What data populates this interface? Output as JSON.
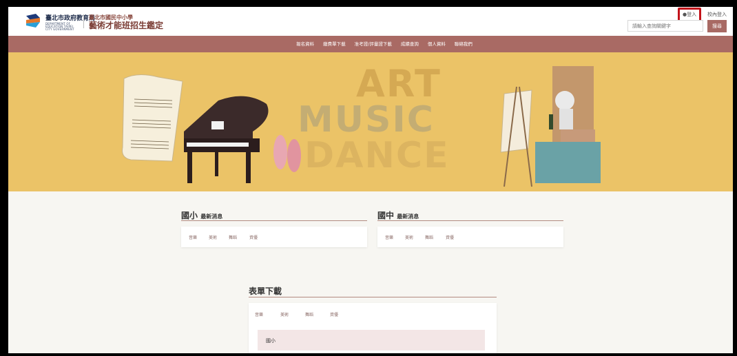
{
  "header": {
    "org_name": "臺北市政府教育局",
    "org_sub": "DEPARTMENT OF EDUCATION TAIPEI CITY GOVERNMENT",
    "site_sub": "臺北市國民中小學",
    "site_title": "藝術才能班招生鑑定",
    "login_label": "登入",
    "teacher_login_label": "校內登入",
    "search_placeholder": "請輸入查詢關鍵字",
    "search_button": "搜尋"
  },
  "nav": {
    "items": [
      "報名資料",
      "繳費單下載",
      "准考證/評量證下載",
      "成績查詢",
      "個人資料",
      "聯絡我們"
    ]
  },
  "banner": {
    "line1": "ART",
    "line2": "MUSIC",
    "line3": "DANCE"
  },
  "news": {
    "elementary": {
      "title": "國小",
      "suffix": "最新消息",
      "tabs": [
        "音樂",
        "美術",
        "舞蹈",
        "資優"
      ]
    },
    "junior": {
      "title": "國中",
      "suffix": "最新消息",
      "tabs": [
        "音樂",
        "美術",
        "舞蹈",
        "資優"
      ]
    }
  },
  "forms": {
    "title": "表單下載",
    "tabs": [
      "音樂",
      "美術",
      "舞蹈",
      "資優"
    ],
    "first_item": "國小"
  },
  "colors": {
    "nav_bg": "#a96a64",
    "banner_bg": "#ebc367",
    "highlight": "#c3131a"
  }
}
